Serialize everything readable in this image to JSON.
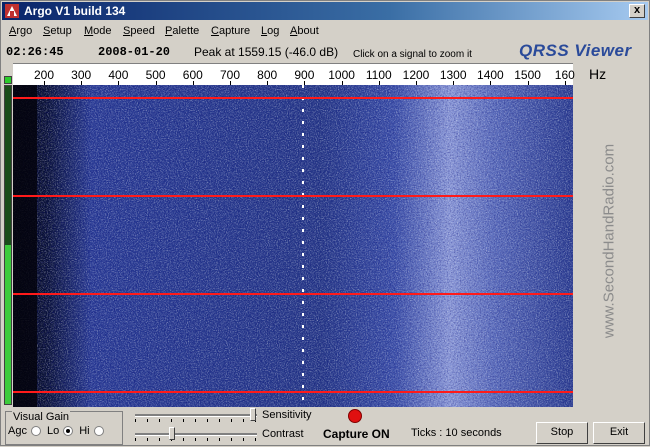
{
  "window": {
    "title": "Argo V1 build 134",
    "close_glyph": "x"
  },
  "menu": [
    "Argo",
    "Setup",
    "Mode",
    "Speed",
    "Palette",
    "Capture",
    "Log",
    "About"
  ],
  "info": {
    "time": "02:26:45",
    "date": "2008-01-20",
    "peak": "Peak at 1559.15 (-46.0 dB)",
    "hint": "Click on a signal to zoom it",
    "brand": "QRSS Viewer"
  },
  "scale": {
    "labels": [
      "200",
      "300",
      "400",
      "500",
      "600",
      "700",
      "800",
      "900",
      "1000",
      "1100",
      "1200",
      "1300",
      "1400",
      "1500",
      "160"
    ],
    "unit": "Hz"
  },
  "signal_level": 0.5,
  "watermark": "www.SecondHandRadio.com",
  "gain": {
    "legend": "Visual Gain",
    "options": [
      {
        "label": "Agc",
        "selected": false
      },
      {
        "label": "Lo",
        "selected": true
      },
      {
        "label": "Hi",
        "selected": false
      }
    ]
  },
  "sensitivity": {
    "label": "Sensitivity",
    "level": 0.97
  },
  "contrast": {
    "label": "Contrast",
    "level": 0.3
  },
  "capture_status": "Capture ON",
  "ticks": "Ticks  : 10 seconds",
  "buttons": {
    "stop": "Stop",
    "exit": "Exit"
  },
  "colors": {
    "waterfall_bg": "#1f2e78",
    "minute_line": "#ff1a1a",
    "brand": "#2a4a9a",
    "record": "#e01010"
  }
}
